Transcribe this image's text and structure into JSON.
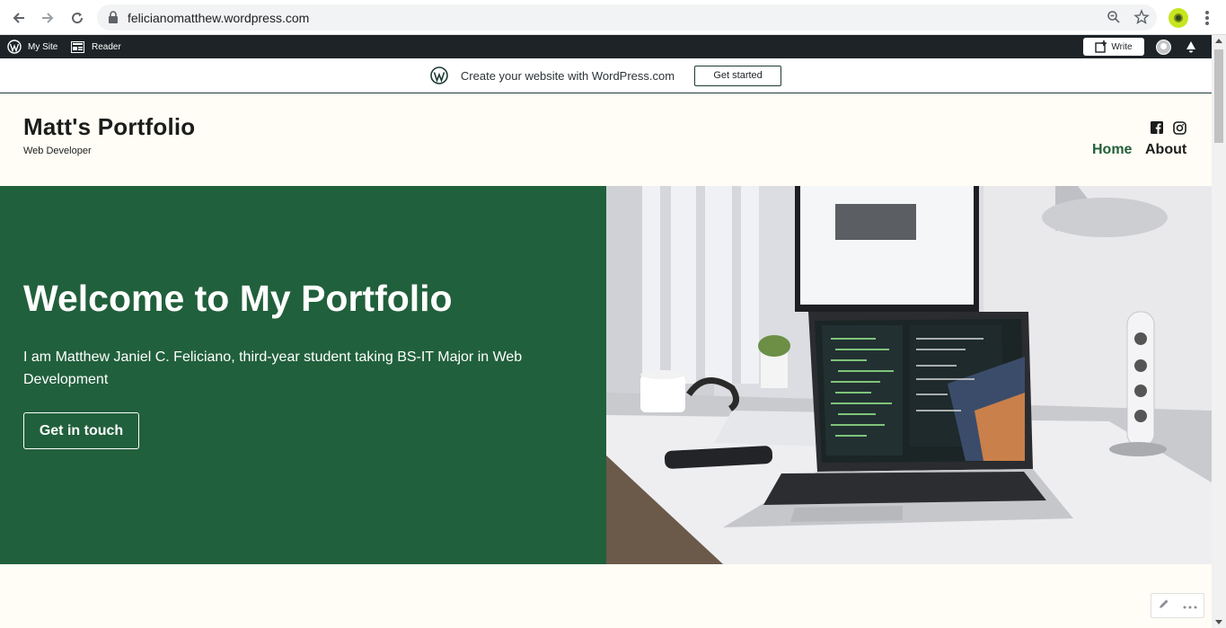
{
  "browser": {
    "url": "felicianomatthew.wordpress.com",
    "icons": [
      "back-icon",
      "forward-icon",
      "reload-icon",
      "lock-icon",
      "zoom-icon",
      "star-icon",
      "profile-icon",
      "menu-icon"
    ]
  },
  "adminbar": {
    "my_site": "My Site",
    "reader": "Reader",
    "write": "Write"
  },
  "banner": {
    "text": "Create your website with WordPress.com",
    "button": "Get started"
  },
  "site": {
    "title": "Matt's Portfolio",
    "tagline": "Web Developer",
    "nav": [
      "Home",
      "About"
    ],
    "social": [
      "facebook-icon",
      "instagram-icon"
    ]
  },
  "hero": {
    "title": "Welcome to My Portfolio",
    "text": "I am Matthew Janiel C. Feliciano, third-year student taking BS-IT Major in Web Development",
    "button": "Get in touch",
    "bg_color": "#21603c"
  },
  "colors": {
    "accent": "#21603c",
    "admin_bar": "#1d2327",
    "site_bg": "#fffdf5"
  }
}
